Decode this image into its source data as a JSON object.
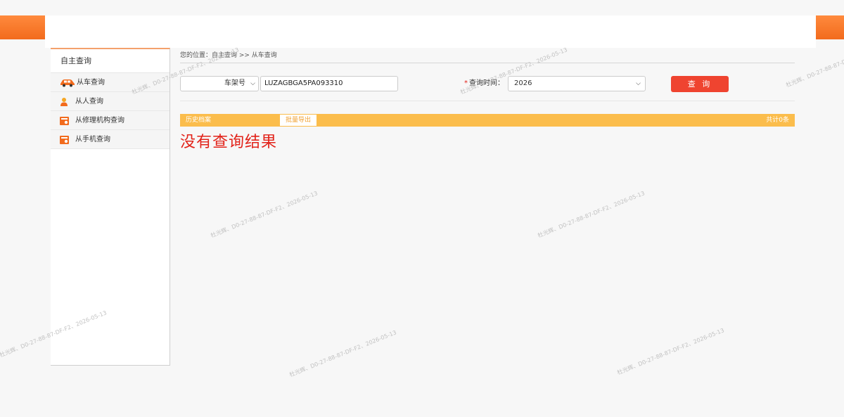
{
  "header": {
    "top_cut_text": "  ",
    "accent_color": "#f26b1d"
  },
  "sidebar": {
    "title": "自主查询",
    "items": [
      {
        "label": "从车查询",
        "icon": "car-icon"
      },
      {
        "label": "从人查询",
        "icon": "person-icon"
      },
      {
        "label": "从修理机构查询",
        "icon": "repair-shop-icon"
      },
      {
        "label": "从手机查询",
        "icon": "phone-icon"
      }
    ]
  },
  "breadcrumb": "您的位置：自主查询 >> 从车查询",
  "search": {
    "type_selected": "车架号",
    "vin_value": "LUZAGBGA5PA093310",
    "time_required_mark": "*",
    "time_label": "查询时间：",
    "year_selected": "2026",
    "query_button": "查 询"
  },
  "history": {
    "label": "历史档案",
    "export_button": "批量导出",
    "count": "共计0条"
  },
  "no_result": "没有查询结果",
  "watermark": "杜光辉、D0-27-88-87-DF-F2、2026-05-13",
  "colors": {
    "orange": "#f26b1d",
    "query_button": "#ef4430",
    "history_bar": "#fbbd4c",
    "no_result": "#e2231a"
  }
}
